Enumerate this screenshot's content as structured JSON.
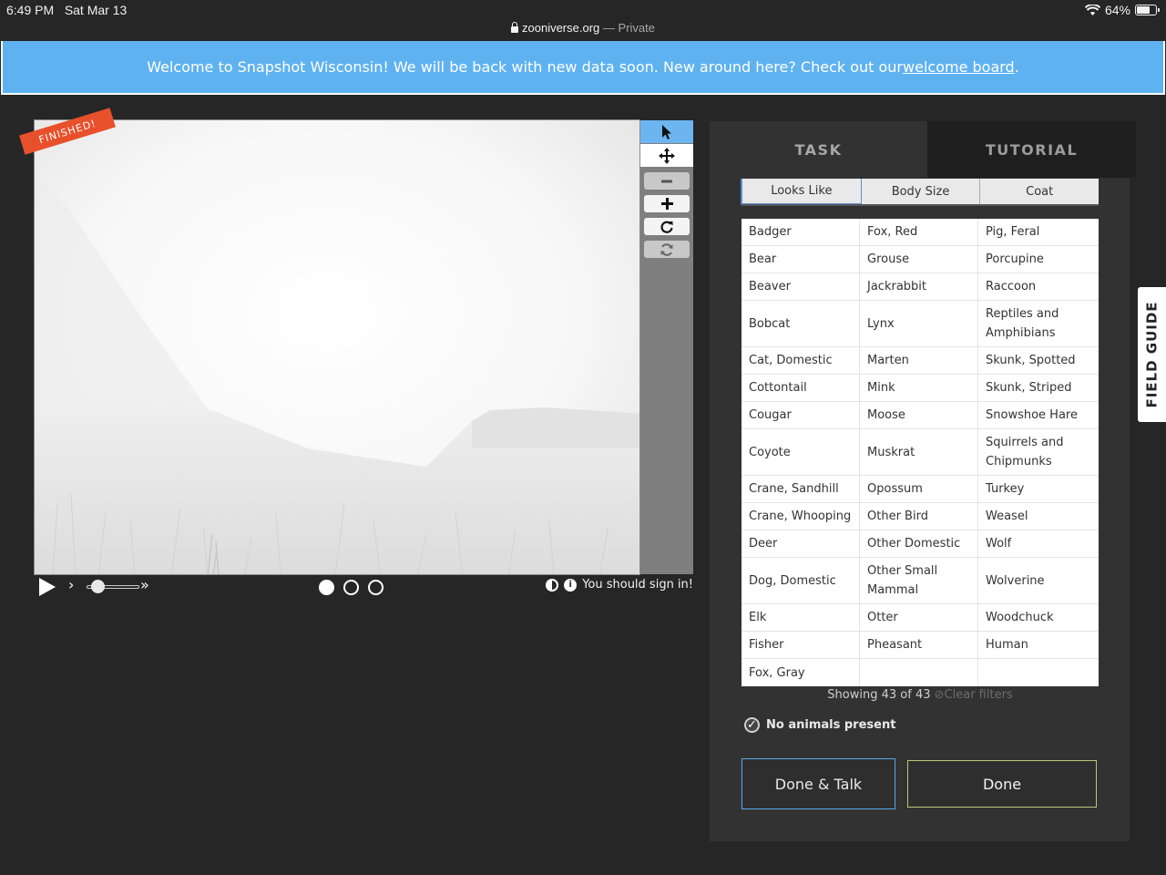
{
  "status_bar": {
    "time": "6:49 PM",
    "date": "Sat Mar 13",
    "url": "zooniverse.org",
    "mode": "— Private",
    "battery": "64%"
  },
  "banner": {
    "text": "Welcome to Snapshot Wisconsin! We will be back with new data soon. New around here? Check out our ",
    "link": "welcome board",
    "end": "."
  },
  "viewer": {
    "ribbon": "FINISHED!",
    "sign_in": "You should sign in!",
    "frames": 3,
    "current_frame": 1
  },
  "tabs": {
    "task": "TASK",
    "tutorial": "TUTORIAL"
  },
  "filters": [
    "Looks Like",
    "Body Size",
    "Coat"
  ],
  "animals": {
    "col1": [
      "Badger",
      "Bear",
      "Beaver",
      "Bobcat",
      "Cat, Domestic",
      "Cottontail",
      "Cougar",
      "Coyote",
      "Crane, Sandhill",
      "Crane, Whooping",
      "Deer",
      "Dog, Domestic",
      "Elk",
      "Fisher",
      "Fox, Gray"
    ],
    "col2": [
      "Fox, Red",
      "Grouse",
      "Jackrabbit",
      "Lynx",
      "Marten",
      "Mink",
      "Moose",
      "Muskrat",
      "Opossum",
      "Other Bird",
      "Other Domestic",
      "Other Small Mammal",
      "Otter",
      "Pheasant"
    ],
    "col3": [
      "Pig, Feral",
      "Porcupine",
      "Raccoon",
      "Reptiles and Amphibians",
      "Skunk, Spotted",
      "Skunk, Striped",
      "Snowshoe Hare",
      "Squirrels and Chipmunks",
      "Turkey",
      "Weasel",
      "Wolf",
      "Wolverine",
      "Woodchuck",
      "Human"
    ]
  },
  "showing": "Showing 43 of 43",
  "clear_filters": "Clear filters",
  "no_animals": "No animals present",
  "buttons": {
    "done_talk": "Done & Talk",
    "done": "Done"
  },
  "field_guide": "FIELD GUIDE",
  "colors": {
    "banner": "#5fb2f0",
    "ribbon": "#e8502b",
    "tool_active": "#6cb5f0"
  }
}
